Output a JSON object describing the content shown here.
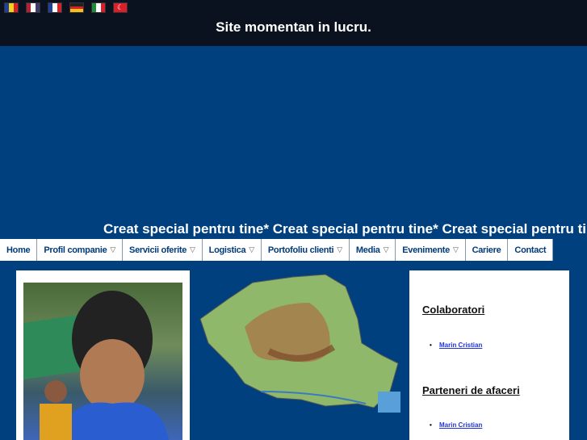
{
  "header": {
    "title": "Site momentan in lucru.",
    "flags": [
      {
        "lang": "ro",
        "colors": [
          "#1f3f9a",
          "#f2d21a",
          "#d8202a"
        ]
      },
      {
        "lang": "en",
        "colors": [
          "#b22234",
          "#ffffff",
          "#3c3b6e"
        ]
      },
      {
        "lang": "fr",
        "colors": [
          "#1f3f9a",
          "#ffffff",
          "#d8202a"
        ]
      },
      {
        "lang": "de",
        "colors": [
          "#222222",
          "#d8202a",
          "#f2c21a"
        ]
      },
      {
        "lang": "it",
        "colors": [
          "#1f8a3a",
          "#ffffff",
          "#d8202a"
        ]
      },
      {
        "lang": "tr",
        "colors": [
          "#d8202a",
          "#d8202a",
          "#d8202a"
        ]
      }
    ]
  },
  "marquee": "Creat special pentru tine* Creat special pentru tine* Creat special pentru tine*",
  "nav": [
    {
      "label": "Home",
      "dropdown": false
    },
    {
      "label": "Profil companie",
      "dropdown": true
    },
    {
      "label": "Servicii oferite",
      "dropdown": true
    },
    {
      "label": "Logistica",
      "dropdown": true
    },
    {
      "label": "Portofoliu clienti",
      "dropdown": true
    },
    {
      "label": "Media",
      "dropdown": true
    },
    {
      "label": "Evenimente",
      "dropdown": true
    },
    {
      "label": "Cariere",
      "dropdown": false
    },
    {
      "label": "Contact",
      "dropdown": false
    }
  ],
  "sidebar": {
    "colaboratori": "Colaboratori",
    "colab_link": "Marin Cristian",
    "parteneri": "Parteneri de afaceri",
    "parteneri_link": "Marin Cristian"
  }
}
